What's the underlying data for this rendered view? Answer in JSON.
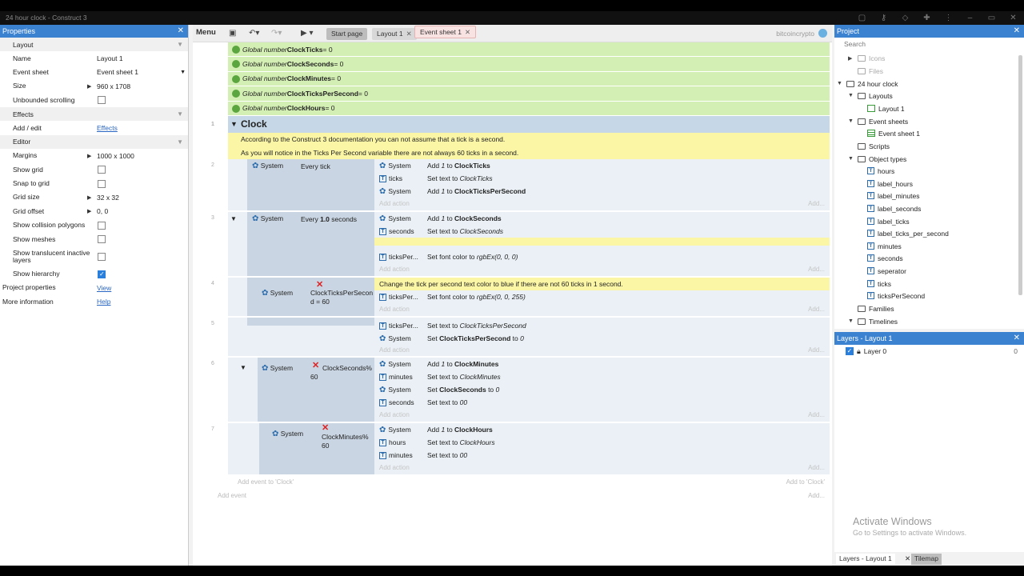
{
  "window": {
    "title": "24 hour clock - Construct 3"
  },
  "properties": {
    "header": "Properties",
    "sections": {
      "layout": "Layout",
      "effects": "Effects",
      "editor": "Editor"
    },
    "name_label": "Name",
    "name_value": "Layout 1",
    "eventsheet_label": "Event sheet",
    "eventsheet_value": "Event sheet 1",
    "size_label": "Size",
    "size_value": "960 x 1708",
    "unbounded_label": "Unbounded scrolling",
    "addedit_label": "Add / edit",
    "addedit_link": "Effects",
    "margins_label": "Margins",
    "margins_value": "1000 x 1000",
    "showgrid_label": "Show grid",
    "snap_label": "Snap to grid",
    "gridsize_label": "Grid size",
    "gridsize_value": "32 x 32",
    "gridoffset_label": "Grid offset",
    "gridoffset_value": "0, 0",
    "collision_label": "Show collision polygons",
    "meshes_label": "Show meshes",
    "translucent_label": "Show translucent inactive layers",
    "hierarchy_label": "Show hierarchy",
    "projprops_label": "Project properties",
    "projprops_link": "View",
    "moreinfo_label": "More information",
    "moreinfo_link": "Help"
  },
  "toolbar": {
    "menu": "Menu",
    "tabs": [
      "Start page",
      "Layout 1",
      "Event sheet 1"
    ],
    "user": "bitcoincrypto"
  },
  "globals": [
    {
      "pre": "Global number ",
      "name": "ClockTicks",
      "val": " = 0"
    },
    {
      "pre": "Global number ",
      "name": "ClockSeconds",
      "val": " = 0"
    },
    {
      "pre": "Global number ",
      "name": "ClockMinutes",
      "val": " = 0"
    },
    {
      "pre": "Global number ",
      "name": "ClockTicksPerSecond",
      "val": " = 0"
    },
    {
      "pre": "Global number ",
      "name": "ClockHours",
      "val": " = 0"
    }
  ],
  "group": {
    "title": "Clock",
    "num": "1"
  },
  "comments": {
    "c1": "According to the Construct 3 documentation you can not assume that a tick is a second.",
    "c2": "As you will notice in the Ticks Per Second variable there are not always 60 ticks in a second.",
    "c3": "Change the tick per second text color to blue if there are not 60 ticks in 1 second."
  },
  "ev2": {
    "num": "2",
    "obj": "System",
    "cond": "Every tick",
    "a1o": "System",
    "a1t1": "Add ",
    "a1t2": "1",
    "a1t3": " to ",
    "a1t4": "ClockTicks",
    "a2o": "ticks",
    "a2t1": "Set text to ",
    "a2t2": "ClockTicks",
    "a3o": "System",
    "a3t1": "Add ",
    "a3t2": "1",
    "a3t3": " to ",
    "a3t4": "ClockTicksPerSecond"
  },
  "ev3": {
    "num": "3",
    "obj": "System",
    "cond1": "Every ",
    "cond2": "1.0",
    "cond3": " seconds",
    "a1o": "System",
    "a1t1": "Add ",
    "a1t2": "1",
    "a1t3": " to ",
    "a1t4": "ClockSeconds",
    "a2o": "seconds",
    "a2t1": "Set text to ",
    "a2t2": "ClockSeconds",
    "a3o": "ticksPer...",
    "a3t1": "Set font color to ",
    "a3t2": "rgbEx(0, 0, 0)"
  },
  "ev4": {
    "num": "4",
    "obj": "System",
    "cond": "ClockTicksPerSecon d = 60",
    "a1o": "ticksPer...",
    "a1t1": "Set font color to ",
    "a1t2": "rgbEx(0, 0, 255)"
  },
  "ev5": {
    "num": "5",
    "a1o": "ticksPer...",
    "a1t1": "Set text to ",
    "a1t2": "ClockTicksPerSecond",
    "a2o": "System",
    "a2t1": "Set ",
    "a2t2": "ClockTicksPerSecond",
    "a2t3": " to ",
    "a2t4": "0"
  },
  "ev6": {
    "num": "6",
    "obj": "System",
    "cond": "ClockSeconds% 60",
    "a1o": "System",
    "a1t1": "Add ",
    "a1t2": "1",
    "a1t3": " to ",
    "a1t4": "ClockMinutes",
    "a2o": "minutes",
    "a2t1": "Set text to ",
    "a2t2": "ClockMinutes",
    "a3o": "System",
    "a3t1": "Set ",
    "a3t2": "ClockSeconds",
    "a3t3": " to ",
    "a3t4": "0",
    "a4o": "seconds",
    "a4t1": "Set text to ",
    "a4t2": "00"
  },
  "ev7": {
    "num": "7",
    "obj": "System",
    "cond": "ClockMinutes% 60",
    "a1o": "System",
    "a1t1": "Add ",
    "a1t2": "1",
    "a1t3": " to ",
    "a1t4": "ClockHours",
    "a2o": "hours",
    "a2t1": "Set text to ",
    "a2t2": "ClockHours",
    "a3o": "minutes",
    "a3t1": "Set text to ",
    "a3t2": "00"
  },
  "hints": {
    "add_action": "Add action",
    "add_dots": "Add...",
    "add_event_to": "Add event to 'Clock'",
    "add_to": "Add to 'Clock'",
    "add_event": "Add event"
  },
  "project": {
    "header": "Project",
    "search_placeholder": "Search",
    "items": [
      "Icons",
      "Files",
      "24 hour clock",
      "Layouts",
      "Layout 1",
      "Event sheets",
      "Event sheet 1",
      "Scripts",
      "Object types",
      "hours",
      "label_hours",
      "label_minutes",
      "label_seconds",
      "label_ticks",
      "label_ticks_per_second",
      "minutes",
      "seconds",
      "seperator",
      "ticks",
      "ticksPerSecond",
      "Families",
      "Timelines"
    ]
  },
  "layers": {
    "header": "Layers - Layout 1",
    "layer0": "Layer 0",
    "layer0_num": "0"
  },
  "bottom_tabs": [
    "Layers - Layout 1",
    "Tilemap"
  ],
  "activate": {
    "title": "Activate Windows",
    "sub": "Go to Settings to activate Windows."
  }
}
